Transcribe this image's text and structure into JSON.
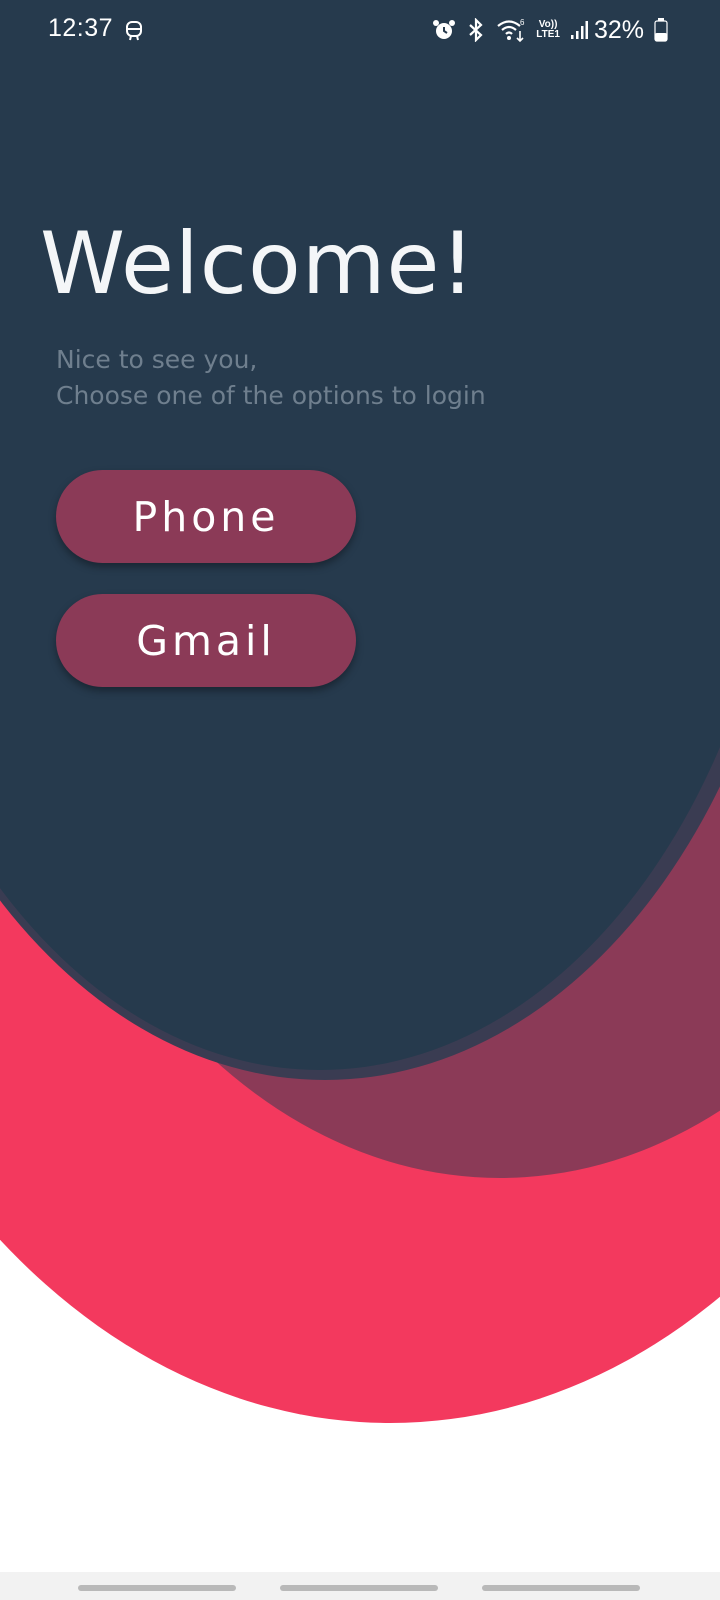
{
  "status_bar": {
    "time": "12:37",
    "battery_percent": "32%",
    "network_label_top": "Vo))",
    "network_label_bottom": "LTE1",
    "icons": [
      "notification-icon",
      "alarm-icon",
      "bluetooth-icon",
      "wifi-6-icon",
      "volte-icon",
      "signal-icon",
      "battery-icon"
    ]
  },
  "main": {
    "title": "Welcome!",
    "subtitle_line1": "Nice to see you,",
    "subtitle_line2": "Choose one of the options to login"
  },
  "buttons": {
    "phone_label": "Phone",
    "gmail_label": "Gmail"
  },
  "colors": {
    "dark_navy": "#263a4d",
    "maroon": "#8b3a57",
    "pink_red": "#f3395e",
    "subtitle_gray": "#6f7f8e",
    "background": "#ffffff"
  }
}
